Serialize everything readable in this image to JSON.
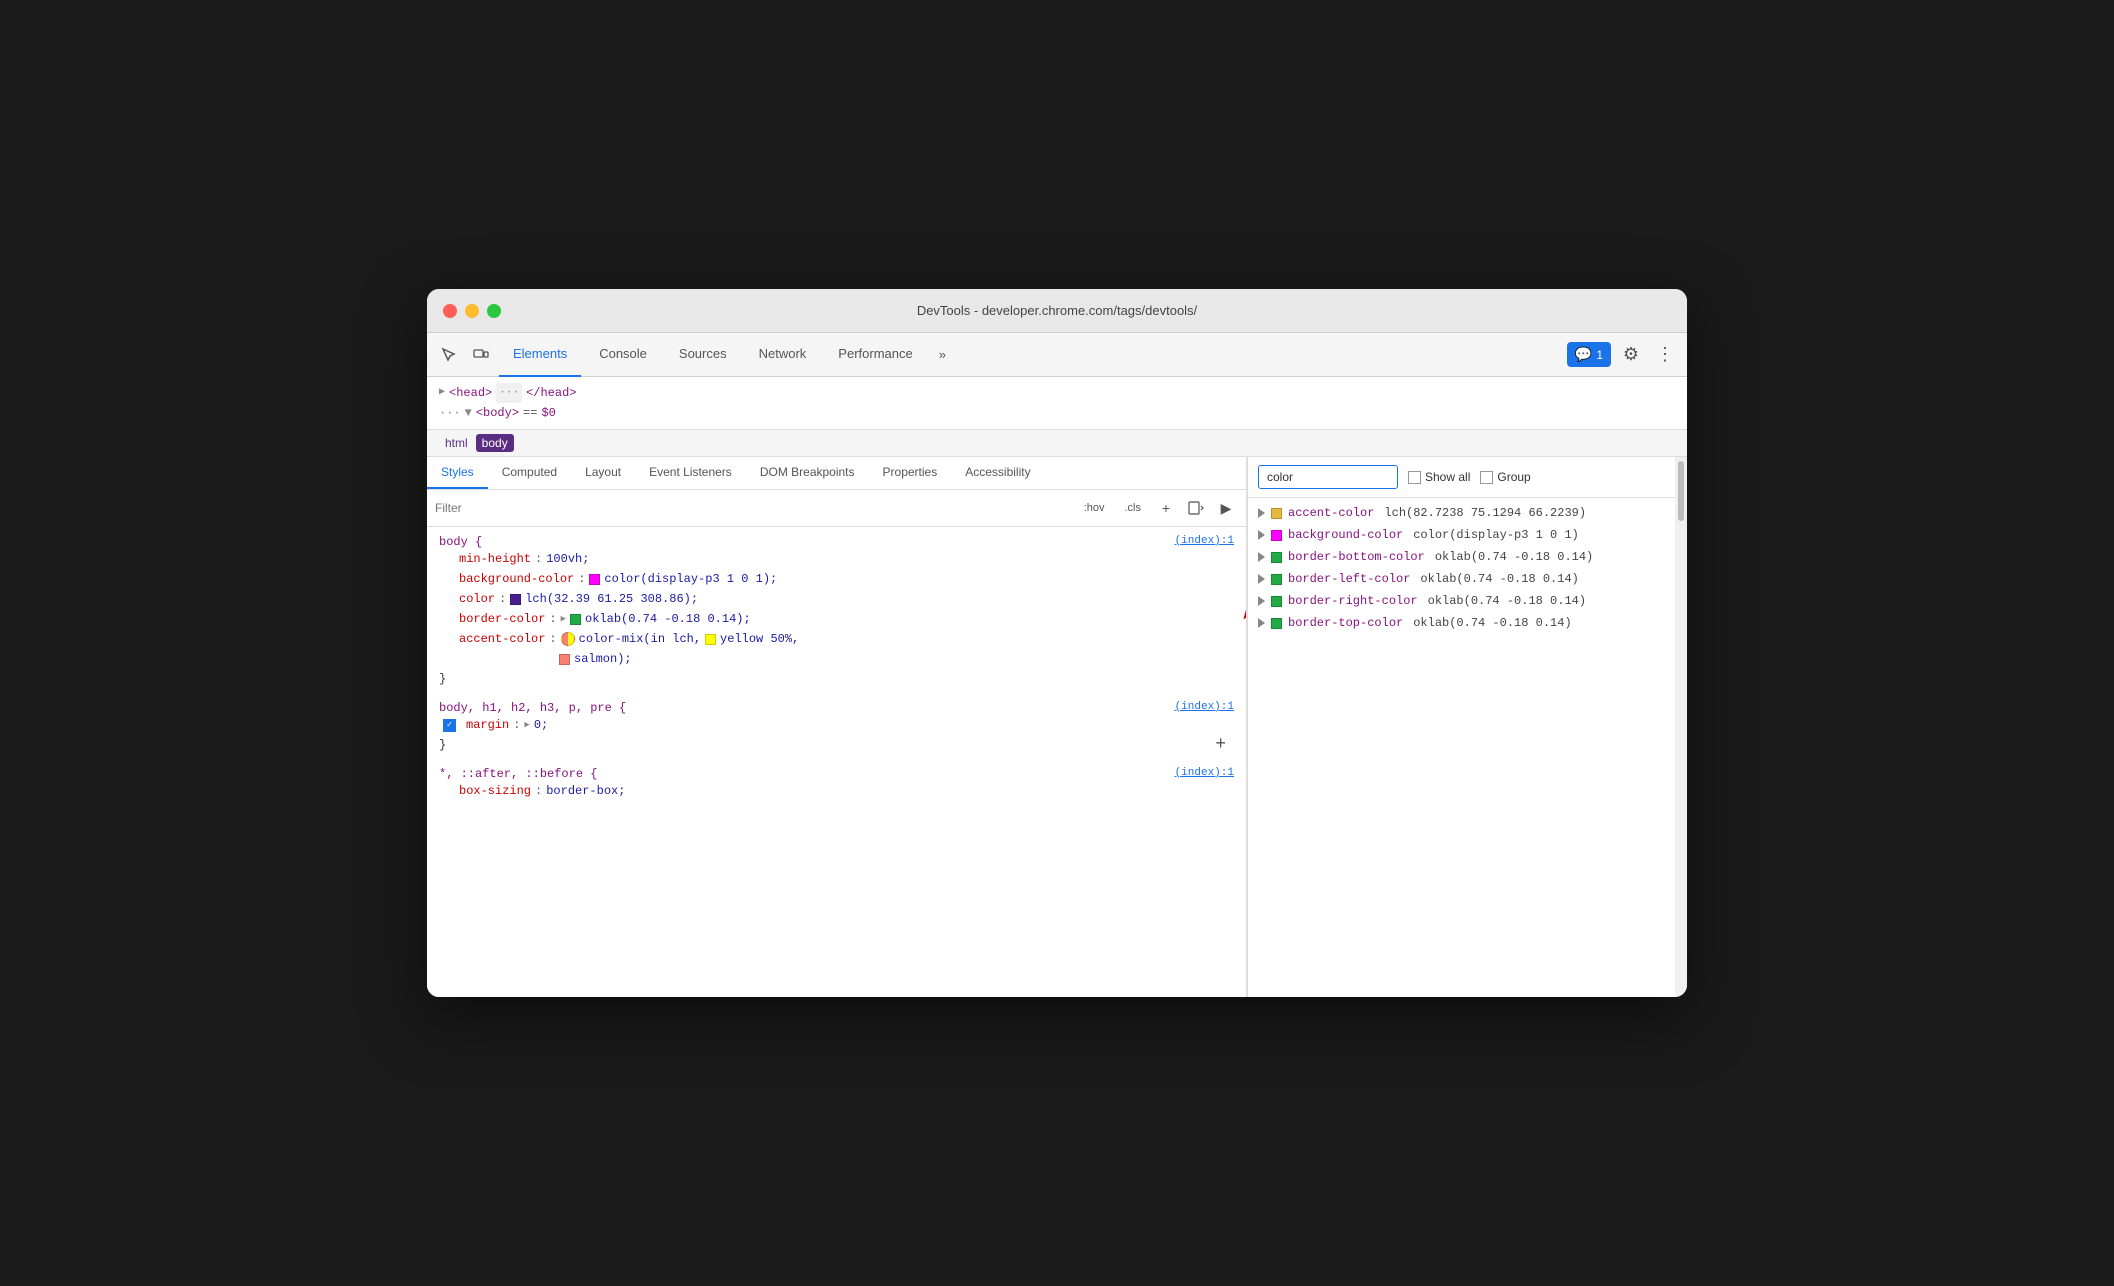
{
  "window": {
    "title": "DevTools - developer.chrome.com/tags/devtools/",
    "traffic_lights": [
      "red",
      "yellow",
      "green"
    ]
  },
  "toolbar": {
    "inspect_label": "Inspect",
    "device_label": "Device",
    "tabs": [
      "Elements",
      "Console",
      "Sources",
      "Network",
      "Performance"
    ],
    "active_tab": "Elements",
    "more_label": "»",
    "badge_label": "1",
    "gear_label": "⚙",
    "more_vert_label": "⋮"
  },
  "dom": {
    "head_text": "<head>",
    "head_end": "</head>",
    "body_text": "<body>",
    "eq_text": "==",
    "dollar_text": "$0",
    "ellipsis": "···"
  },
  "breadcrumb": {
    "items": [
      "html",
      "body"
    ]
  },
  "tabs": {
    "items": [
      "Styles",
      "Computed",
      "Layout",
      "Event Listeners",
      "DOM Breakpoints",
      "Properties",
      "Accessibility"
    ],
    "active": "Styles"
  },
  "filter": {
    "placeholder": "Filter",
    "hov_label": ":hov",
    "cls_label": ".cls",
    "add_label": "+",
    "icon1": "⊞",
    "icon2": "▶"
  },
  "css_rules": [
    {
      "selector": "body {",
      "source": "(index):1",
      "properties": [
        {
          "name": "min-height",
          "value": "100vh;"
        },
        {
          "name": "background-color",
          "value": "color(display-p3 1 0 1);",
          "swatch": "#ff00ff",
          "swatch_type": "solid"
        },
        {
          "name": "color",
          "value": "lch(32.39 61.25 308.86);",
          "swatch": "#4a2090",
          "swatch_type": "solid"
        },
        {
          "name": "border-color",
          "value": "oklab(0.74 -0.18 0.14);",
          "swatch": "#22aa44",
          "swatch_type": "solid",
          "has_arrow": true
        },
        {
          "name": "accent-color",
          "value": "color-mix(in lch,",
          "value2": "yellow 50%,",
          "value3": "salmon);",
          "swatch": "mix",
          "has_yellow": true,
          "has_salmon": true
        }
      ],
      "close": "}"
    },
    {
      "selector": "body, h1, h2, h3, p, pre {",
      "source": "(index):1",
      "properties": [
        {
          "name": "margin",
          "value": "0;",
          "has_checkbox": true,
          "has_expand": true
        }
      ],
      "close": "}",
      "has_add": true
    },
    {
      "selector": "*, ::after, ::before {",
      "source": "(index):1",
      "properties": [
        {
          "name": "box-sizing",
          "value": "border-box;"
        }
      ]
    }
  ],
  "right_panel": {
    "search_placeholder": "color",
    "search_value": "color",
    "show_all_label": "Show all",
    "group_label": "Group",
    "computed_props": [
      {
        "name": "accent-color",
        "value": "lch(82.7238 75.1294 66.2239)",
        "swatch": "#e8b840",
        "has_arrow_annotation": true
      },
      {
        "name": "background-color",
        "value": "color(display-p3 1 0 1)",
        "swatch": "#ff00ff"
      },
      {
        "name": "border-bottom-color",
        "value": "oklab(0.74 -0.18 0.14)",
        "swatch": "#22aa44"
      },
      {
        "name": "border-left-color",
        "value": "oklab(0.74 -0.18 0.14)",
        "swatch": "#22aa44"
      },
      {
        "name": "border-right-color",
        "value": "oklab(0.74 -0.18 0.14)",
        "swatch": "#22aa44"
      },
      {
        "name": "border-top-color",
        "value": "oklab(0.74 -0.18 0.14)",
        "swatch": "#22aa44"
      }
    ]
  }
}
